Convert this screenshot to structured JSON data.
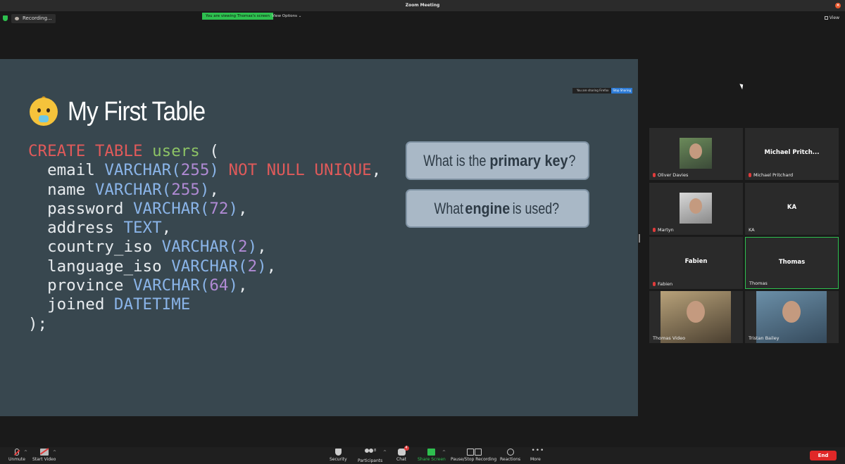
{
  "window": {
    "title": "Zoom Meeting"
  },
  "topbar": {
    "recording_label": "Recording...",
    "viewing_banner": "You are viewing Thomas's screen",
    "view_options_label": "View Options",
    "view_button_label": "View"
  },
  "share_notice": {
    "text": "You are sharing Firefox",
    "stop_label": "Stop Sharing"
  },
  "slide": {
    "title": "My First Table",
    "title_icon": "baby-emoji-icon",
    "code_lines": [
      [
        {
          "t": "CREATE TABLE ",
          "c": "kw"
        },
        {
          "t": "users",
          "c": "fn"
        },
        {
          "t": " (",
          "c": ""
        }
      ],
      [
        {
          "t": "  email ",
          "c": ""
        },
        {
          "t": "VARCHAR(",
          "c": "ty"
        },
        {
          "t": "255",
          "c": "nm"
        },
        {
          "t": ")",
          "c": "ty"
        },
        {
          "t": " NOT NULL UNIQUE",
          "c": "kw"
        },
        {
          "t": ",",
          "c": ""
        }
      ],
      [
        {
          "t": "  name ",
          "c": ""
        },
        {
          "t": "VARCHAR(",
          "c": "ty"
        },
        {
          "t": "255",
          "c": "nm"
        },
        {
          "t": ")",
          "c": "ty"
        },
        {
          "t": ",",
          "c": ""
        }
      ],
      [
        {
          "t": "  password ",
          "c": ""
        },
        {
          "t": "VARCHAR(",
          "c": "ty"
        },
        {
          "t": "72",
          "c": "nm"
        },
        {
          "t": ")",
          "c": "ty"
        },
        {
          "t": ",",
          "c": ""
        }
      ],
      [
        {
          "t": "  address ",
          "c": ""
        },
        {
          "t": "TEXT",
          "c": "ty"
        },
        {
          "t": ",",
          "c": ""
        }
      ],
      [
        {
          "t": "  country_iso ",
          "c": ""
        },
        {
          "t": "VARCHAR(",
          "c": "ty"
        },
        {
          "t": "2",
          "c": "nm"
        },
        {
          "t": ")",
          "c": "ty"
        },
        {
          "t": ",",
          "c": ""
        }
      ],
      [
        {
          "t": "  language_iso ",
          "c": ""
        },
        {
          "t": "VARCHAR(",
          "c": "ty"
        },
        {
          "t": "2",
          "c": "nm"
        },
        {
          "t": ")",
          "c": "ty"
        },
        {
          "t": ",",
          "c": ""
        }
      ],
      [
        {
          "t": "  province ",
          "c": ""
        },
        {
          "t": "VARCHAR(",
          "c": "ty"
        },
        {
          "t": "64",
          "c": "nm"
        },
        {
          "t": ")",
          "c": "ty"
        },
        {
          "t": ",",
          "c": ""
        }
      ],
      [
        {
          "t": "  joined ",
          "c": ""
        },
        {
          "t": "DATETIME",
          "c": "ty"
        }
      ],
      [
        {
          "t": ");",
          "c": ""
        }
      ]
    ],
    "questions": [
      {
        "before": "What is the ",
        "bold": "primary key",
        "after": "?"
      },
      {
        "before": "What ",
        "bold": "engine",
        "after": " is used?"
      }
    ]
  },
  "participants": [
    {
      "label": "Oliver Davies",
      "big": "",
      "muted": true,
      "video": true,
      "active": false
    },
    {
      "label": "Michael Pritchard",
      "big": "Michael Pritch...",
      "muted": true,
      "video": false,
      "active": false
    },
    {
      "label": "Martyn",
      "big": "",
      "muted": true,
      "video": true,
      "active": false
    },
    {
      "label": "KA",
      "big": "KA",
      "muted": false,
      "video": false,
      "active": false
    },
    {
      "label": "Fabien",
      "big": "Fabien",
      "muted": true,
      "video": false,
      "active": false
    },
    {
      "label": "Thomas",
      "big": "Thomas",
      "muted": false,
      "video": false,
      "active": true
    },
    {
      "label": "Thomas Video",
      "big": "",
      "muted": false,
      "video": true,
      "active": false
    },
    {
      "label": "Tristan Bailey",
      "big": "",
      "muted": false,
      "video": true,
      "active": false
    }
  ],
  "toolbar": {
    "unmute": "Unmute",
    "start_video": "Start Video",
    "security": "Security",
    "participants": "Participants",
    "participants_count": "8",
    "chat": "Chat",
    "chat_badge": "4",
    "share_screen": "Share Screen",
    "pause_recording": "Pause/Stop Recording",
    "reactions": "Reactions",
    "more": "More",
    "end": "End"
  },
  "colors": {
    "slide_bg": "#38474f",
    "keyword": "#e05a5a",
    "identifier": "#8cc265",
    "type": "#8ab4e8",
    "number": "#b08ad4",
    "question_box": "#a9b8c6",
    "active_green": "#2ec04f",
    "end_red": "#e02828"
  }
}
